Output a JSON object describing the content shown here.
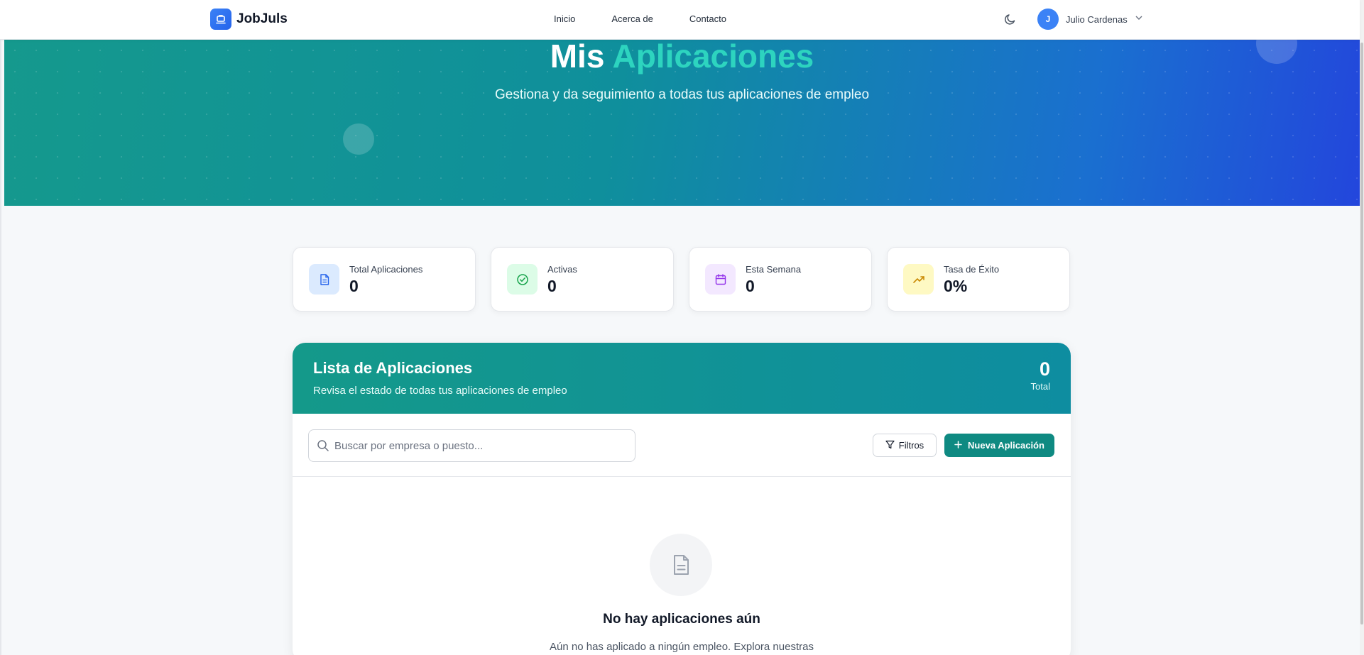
{
  "nav": {
    "brand": "JobJuls",
    "links": [
      "Inicio",
      "Acerca de",
      "Contacto"
    ],
    "user": {
      "initial": "J",
      "name": "Julio Cardenas"
    }
  },
  "hero": {
    "title_main": "Mis",
    "title_accent": "Aplicaciones",
    "subtitle": "Gestiona y da seguimiento a todas tus aplicaciones de empleo"
  },
  "stats": [
    {
      "label": "Total Aplicaciones",
      "value": "0",
      "icon": "document-icon",
      "color": "#2563eb",
      "bg": "#dbeafe"
    },
    {
      "label": "Activas",
      "value": "0",
      "icon": "check-circle-icon",
      "color": "#16a34a",
      "bg": "#dcfce7"
    },
    {
      "label": "Esta Semana",
      "value": "0",
      "icon": "calendar-icon",
      "color": "#9333ea",
      "bg": "#f3e8ff"
    },
    {
      "label": "Tasa de Éxito",
      "value": "0%",
      "icon": "trending-up-icon",
      "color": "#ca8a04",
      "bg": "#fef9c3"
    }
  ],
  "panel": {
    "title": "Lista de Aplicaciones",
    "subtitle": "Revisa el estado de todas tus aplicaciones de empleo",
    "count": "0",
    "count_label": "Total",
    "search_placeholder": "Buscar por empresa o puesto...",
    "filter_label": "Filtros",
    "new_label": "Nueva Aplicación",
    "empty_title": "No hay aplicaciones aún",
    "empty_desc": "Aún no has aplicado a ningún empleo. Explora nuestras"
  },
  "colors": {
    "primary": "#0f8a82",
    "accent": "#2dd4bf",
    "brand_blue": "#3b82f6"
  }
}
